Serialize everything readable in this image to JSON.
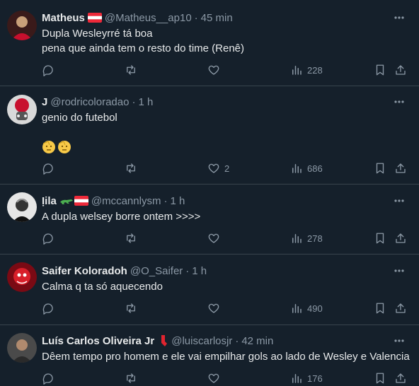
{
  "tweets": [
    {
      "name": "Matheus",
      "handle": "@Matheus__ap10",
      "time": "45 min",
      "badges": [
        "flag-austria-icon"
      ],
      "lines": [
        "Dupla Wesleyrré tá boa",
        "pena que ainda tem o resto do time (Renê)"
      ],
      "replies": "",
      "retweets": "",
      "likes": "",
      "views": "228"
    },
    {
      "name": "J",
      "handle": "@rodricoloradao",
      "time": "1 h",
      "badges": [],
      "lines": [
        "genio do futebol",
        "",
        "🫡🫡"
      ],
      "replies": "",
      "retweets": "",
      "likes": "2",
      "views": "686"
    },
    {
      "name": "Ịila",
      "handle": "@mccannlysm",
      "time": "1 h",
      "badges": [
        "crocodile-icon",
        "flag-austria-icon"
      ],
      "lines": [
        "A dupla welsey borre ontem >>>>"
      ],
      "replies": "",
      "retweets": "",
      "likes": "",
      "views": "278"
    },
    {
      "name": "Saifer Koloradoh",
      "handle": "@O_Saifer",
      "time": "1 h",
      "badges": [],
      "lines": [
        "Calma q ta só aquecendo"
      ],
      "replies": "",
      "retweets": "",
      "likes": "",
      "views": "490"
    },
    {
      "name": "Luís Carlos Oliveira Jr",
      "handle": "@luiscarlosjr",
      "time": "42 min",
      "badges": [
        "red-sock-icon"
      ],
      "lines": [
        "Dêem tempo pro homem e ele vai empilhar gols ao lado de Wesley e Valencia"
      ],
      "replies": "",
      "retweets": "",
      "likes": "",
      "views": "176"
    }
  ],
  "separator": "·",
  "more_icon": "ellipsis-icon",
  "colors": {
    "background": "#15202b",
    "text": "#e7e9ea",
    "muted": "#8b98a5",
    "border": "#38444d"
  }
}
